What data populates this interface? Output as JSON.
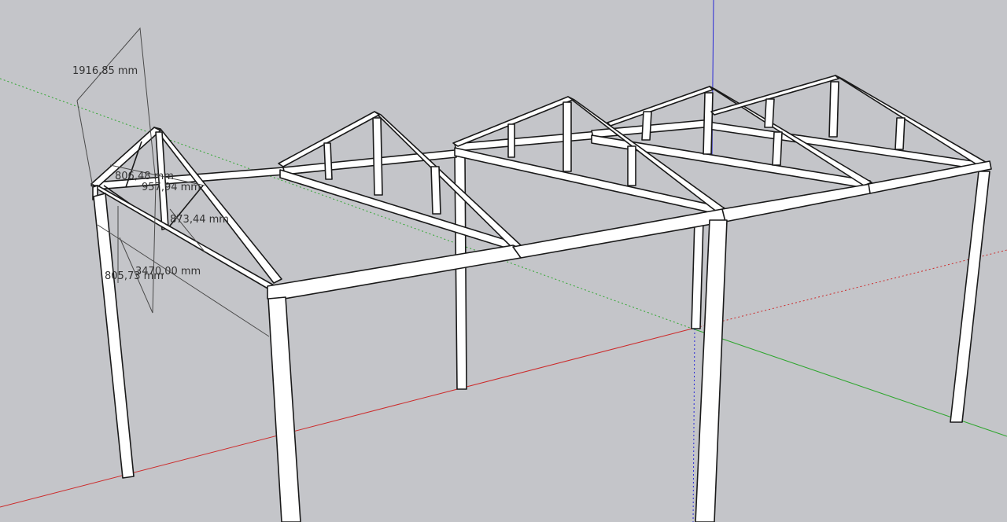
{
  "viewport": {
    "background": "#c4c5c9",
    "axes": {
      "red": "#cc2b2b",
      "green": "#2ea62e",
      "blue": "#2a2ad6"
    }
  },
  "dimensions": {
    "d1": "1916,85 mm",
    "d2": "806,48 mm",
    "d3": "957,94 mm",
    "d4": "873,44 mm",
    "d5": "3470,00 mm",
    "d6": "805,73 mm"
  }
}
